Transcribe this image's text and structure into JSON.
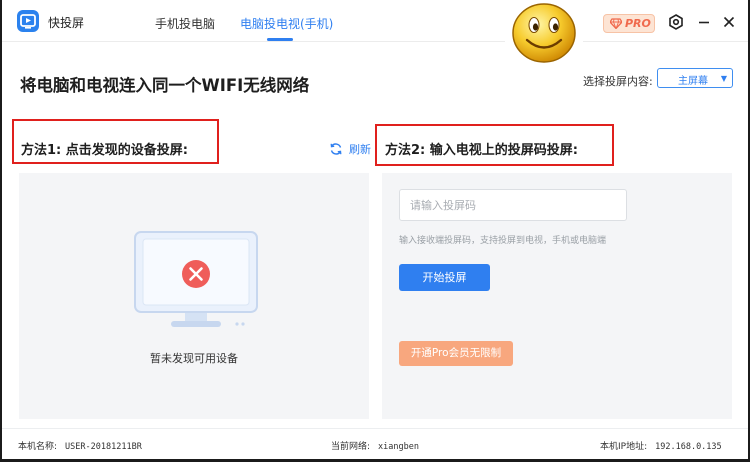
{
  "app": {
    "name": "快投屏",
    "tabs": [
      "手机投电脑",
      "电脑投电视(手机)"
    ],
    "active_tab": 1,
    "pro_badge": "PRO"
  },
  "main": {
    "headline": "将电脑和电视连入同一个WIFI无线网络",
    "select_label": "选择投屏内容:",
    "select_value": "主屏幕"
  },
  "method1": {
    "title": "方法1: 点击发现的设备投屏:",
    "refresh_label": "刷新",
    "empty_text": "暂未发现可用设备"
  },
  "method2": {
    "title": "方法2: 输入电视上的投屏码投屏:",
    "input_placeholder": "请输入投屏码",
    "hint": "输入接收端投屏码，支持投屏到电视，手机或电脑端",
    "start_button": "开始投屏",
    "pro_button": "开通Pro会员无限制"
  },
  "status": {
    "hostname_label": "本机名称:",
    "hostname_value": "USER-20181211BR",
    "network_label": "当前网络:",
    "network_value": "xiangben",
    "ip_label": "本机IP地址:",
    "ip_value": "192.168.0.135"
  },
  "colors": {
    "accent": "#2f7ff0",
    "highlight_border": "#e0201d",
    "pro_orange": "#f8a77e",
    "error_red": "#ef5d5a"
  }
}
